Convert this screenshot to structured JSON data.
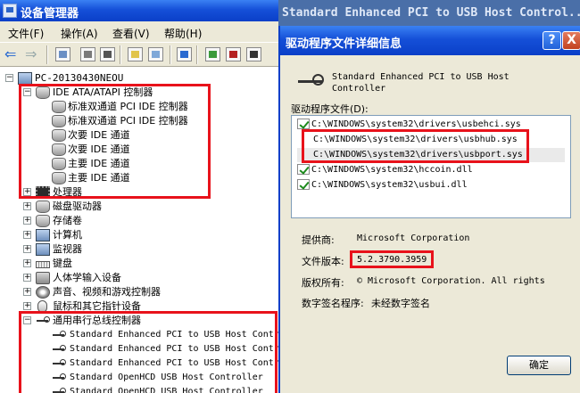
{
  "device_manager": {
    "title": "设备管理器",
    "menu": [
      "文件(F)",
      "操作(A)",
      "查看(V)",
      "帮助(H)"
    ],
    "tree": {
      "computer": "PC-20130430NEOU",
      "ide_controllers": {
        "label": "IDE ATA/ATAPI 控制器",
        "children": [
          "标准双通道 PCI IDE 控制器",
          "标准双通道 PCI IDE 控制器",
          "次要 IDE 通道",
          "次要 IDE 通道",
          "主要 IDE 通道",
          "主要 IDE 通道"
        ]
      },
      "categories": [
        "处理器",
        "磁盘驱动器",
        "存储卷",
        "计算机",
        "监视器",
        "键盘",
        "人体学输入设备",
        "声音、视频和游戏控制器",
        "鼠标和其它指针设备"
      ],
      "usb_controllers": {
        "label": "通用串行总线控制器",
        "children": [
          "Standard Enhanced PCI to USB Host Controller",
          "Standard Enhanced PCI to USB Host Controller",
          "Standard Enhanced PCI to USB Host Controller",
          "Standard OpenHCD USB Host Controller",
          "Standard OpenHCD USB Host Controller"
        ]
      }
    }
  },
  "background_header": "Standard Enhanced PCI to USB Host Control...",
  "dialog": {
    "title": "驱动程序文件详细信息",
    "help_btn": "?",
    "close_btn": "X",
    "device_name": "Standard Enhanced PCI to USB Host Controller",
    "files_label": "驱动程序文件(D):",
    "files": [
      {
        "path": "C:\\WINDOWS\\system32\\drivers\\usbehci.sys",
        "signed": true
      },
      {
        "path": "C:\\WINDOWS\\system32\\drivers\\usbhub.sys",
        "signed": false
      },
      {
        "path": "C:\\WINDOWS\\system32\\drivers\\usbport.sys",
        "signed": false
      },
      {
        "path": "C:\\WINDOWS\\system32\\hccoin.dll",
        "signed": true
      },
      {
        "path": "C:\\WINDOWS\\system32\\usbui.dll",
        "signed": true
      }
    ],
    "provider_label": "提供商:",
    "provider": "Microsoft Corporation",
    "version_label": "文件版本:",
    "version": "5.2.3790.3959",
    "copyright_label": "版权所有:",
    "copyright": "© Microsoft Corporation. All rights",
    "signer_label": "数字签名程序:",
    "signer": "未经数字签名",
    "ok": "确定"
  }
}
